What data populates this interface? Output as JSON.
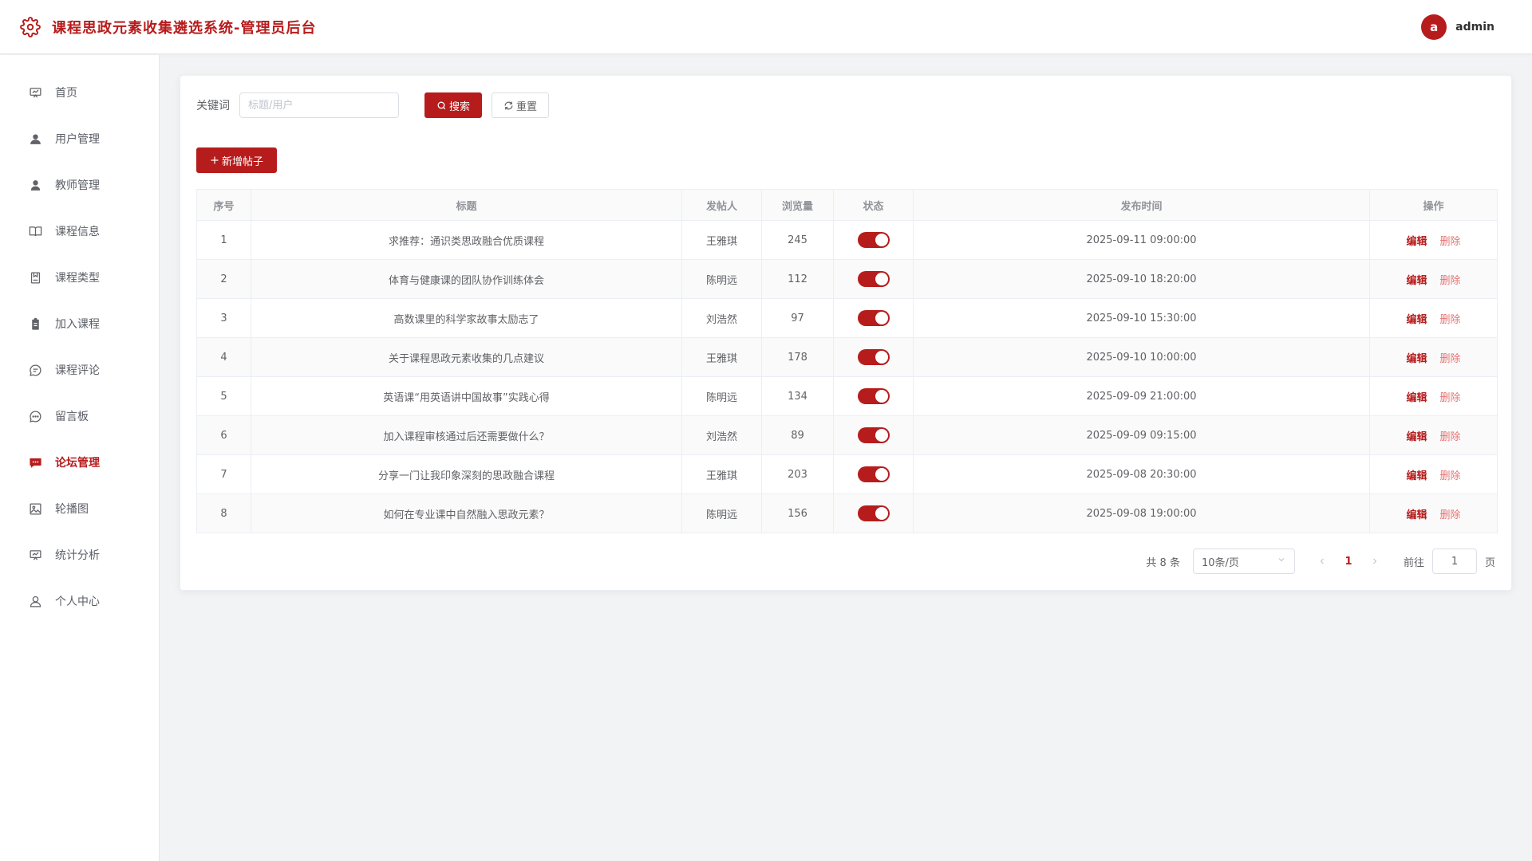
{
  "header": {
    "title": "课程思政元素收集遴选系统-管理员后台",
    "avatar_letter": "a",
    "username": "admin"
  },
  "sidebar": {
    "items": [
      {
        "label": "首页",
        "icon": "presentation-icon"
      },
      {
        "label": "用户管理",
        "icon": "user-filled-icon"
      },
      {
        "label": "教师管理",
        "icon": "user-icon"
      },
      {
        "label": "课程信息",
        "icon": "book-open-icon"
      },
      {
        "label": "课程类型",
        "icon": "bookmark-icon"
      },
      {
        "label": "加入课程",
        "icon": "clipboard-icon"
      },
      {
        "label": "课程评论",
        "icon": "comment-icon"
      },
      {
        "label": "留言板",
        "icon": "chat-dots-icon"
      },
      {
        "label": "论坛管理",
        "icon": "chat-filled-icon",
        "active": true
      },
      {
        "label": "轮播图",
        "icon": "picture-icon"
      },
      {
        "label": "统计分析",
        "icon": "presentation-icon"
      },
      {
        "label": "个人中心",
        "icon": "user-outline-icon"
      }
    ]
  },
  "search": {
    "label": "关键词",
    "placeholder": "标题/用户",
    "value": "",
    "search_label": "搜索",
    "reset_label": "重置"
  },
  "toolbar": {
    "add_label": "新增帖子"
  },
  "table": {
    "columns": [
      "序号",
      "标题",
      "发帖人",
      "浏览量",
      "状态",
      "发布时间",
      "操作"
    ],
    "rows": [
      {
        "no": "1",
        "title": "求推荐：通识类思政融合优质课程",
        "author": "王雅琪",
        "views": "245",
        "status": true,
        "time": "2025-09-11 09:00:00"
      },
      {
        "no": "2",
        "title": "体育与健康课的团队协作训练体会",
        "author": "陈明远",
        "views": "112",
        "status": true,
        "time": "2025-09-10 18:20:00"
      },
      {
        "no": "3",
        "title": "高数课里的科学家故事太励志了",
        "author": "刘浩然",
        "views": "97",
        "status": true,
        "time": "2025-09-10 15:30:00"
      },
      {
        "no": "4",
        "title": "关于课程思政元素收集的几点建议",
        "author": "王雅琪",
        "views": "178",
        "status": true,
        "time": "2025-09-10 10:00:00"
      },
      {
        "no": "5",
        "title": "英语课“用英语讲中国故事”实践心得",
        "author": "陈明远",
        "views": "134",
        "status": true,
        "time": "2025-09-09 21:00:00"
      },
      {
        "no": "6",
        "title": "加入课程审核通过后还需要做什么？",
        "author": "刘浩然",
        "views": "89",
        "status": true,
        "time": "2025-09-09 09:15:00"
      },
      {
        "no": "7",
        "title": "分享一门让我印象深刻的思政融合课程",
        "author": "王雅琪",
        "views": "203",
        "status": true,
        "time": "2025-09-08 20:30:00"
      },
      {
        "no": "8",
        "title": "如何在专业课中自然融入思政元素？",
        "author": "陈明远",
        "views": "156",
        "status": true,
        "time": "2025-09-08 19:00:00"
      }
    ],
    "edit_label": "编辑",
    "delete_label": "删除"
  },
  "pagination": {
    "total_text": "共 8 条",
    "page_size": "10条/页",
    "current_page": "1",
    "goto_label": "前往",
    "goto_value": "1",
    "page_suffix": "页"
  },
  "colors": {
    "primary": "#b71c1c",
    "danger_light": "#e57373"
  }
}
